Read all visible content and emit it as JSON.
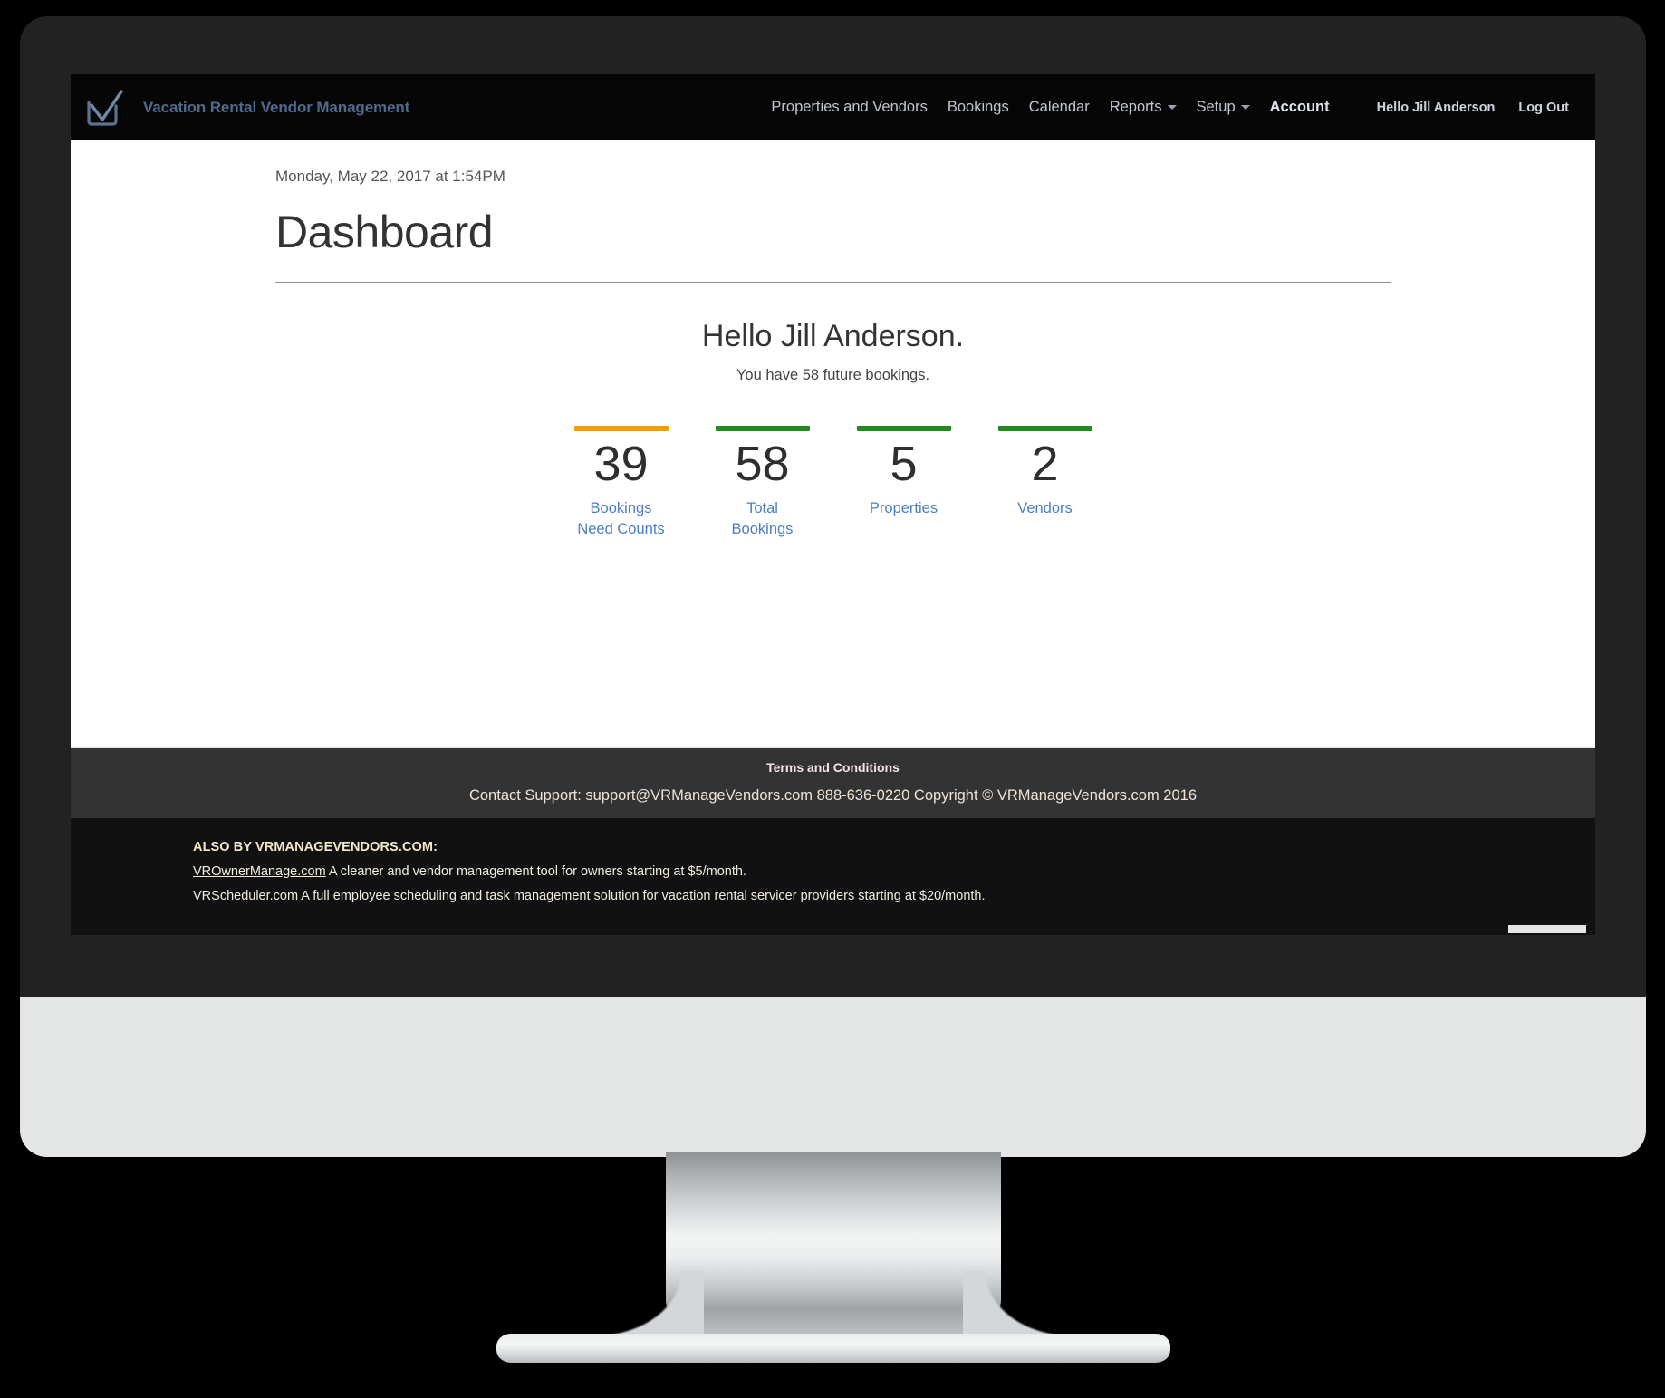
{
  "brand": {
    "logo_icon": "checkbox-check-icon",
    "title": "Vacation Rental Vendor Management"
  },
  "nav": {
    "items": [
      {
        "label": "Properties and Vendors",
        "caret": false,
        "emphasis": false
      },
      {
        "label": "Bookings",
        "caret": false,
        "emphasis": false
      },
      {
        "label": "Calendar",
        "caret": false,
        "emphasis": false
      },
      {
        "label": "Reports",
        "caret": true,
        "emphasis": false
      },
      {
        "label": "Setup",
        "caret": true,
        "emphasis": false
      },
      {
        "label": "Account",
        "caret": false,
        "emphasis": true
      }
    ],
    "user": [
      {
        "label": "Hello Jill Anderson"
      },
      {
        "label": "Log Out"
      }
    ]
  },
  "page": {
    "date": "Monday, May 22, 2017 at 1:54PM",
    "title": "Dashboard",
    "greeting": "Hello Jill Anderson.",
    "greeting_sub": "You have 58 future bookings."
  },
  "stats": [
    {
      "value": "39",
      "label": "Bookings Need Counts",
      "color": "#f0a000"
    },
    {
      "value": "58",
      "label": "Total Bookings",
      "color": "#1f8a1f"
    },
    {
      "value": "5",
      "label": "Properties",
      "color": "#1f8a1f"
    },
    {
      "value": "2",
      "label": "Vendors",
      "color": "#1f8a1f"
    }
  ],
  "footer": {
    "terms": "Terms and Conditions",
    "support": "Contact Support: support@VRManageVendors.com 888-636-0220 Copyright © VRManageVendors.com 2016",
    "also_by_heading": "ALSO BY VRMANAGEVENDORS.COM:",
    "promos": [
      {
        "link": "VROwnerManage.com",
        "text": " A cleaner and vendor management tool for owners starting at $5/month."
      },
      {
        "link": "VRScheduler.com",
        "text": " A full employee scheduling and task management solution for vacation rental servicer providers starting at $20/month."
      }
    ]
  },
  "colors": {
    "navbar_bg": "#060606",
    "brand_text": "#4e6a8e",
    "stat_label": "#4a7ec4",
    "footer_primary_bg": "#333333",
    "footer_secondary_bg": "#111111",
    "accent_warning": "#f0a000",
    "accent_ok": "#1f8a1f"
  }
}
